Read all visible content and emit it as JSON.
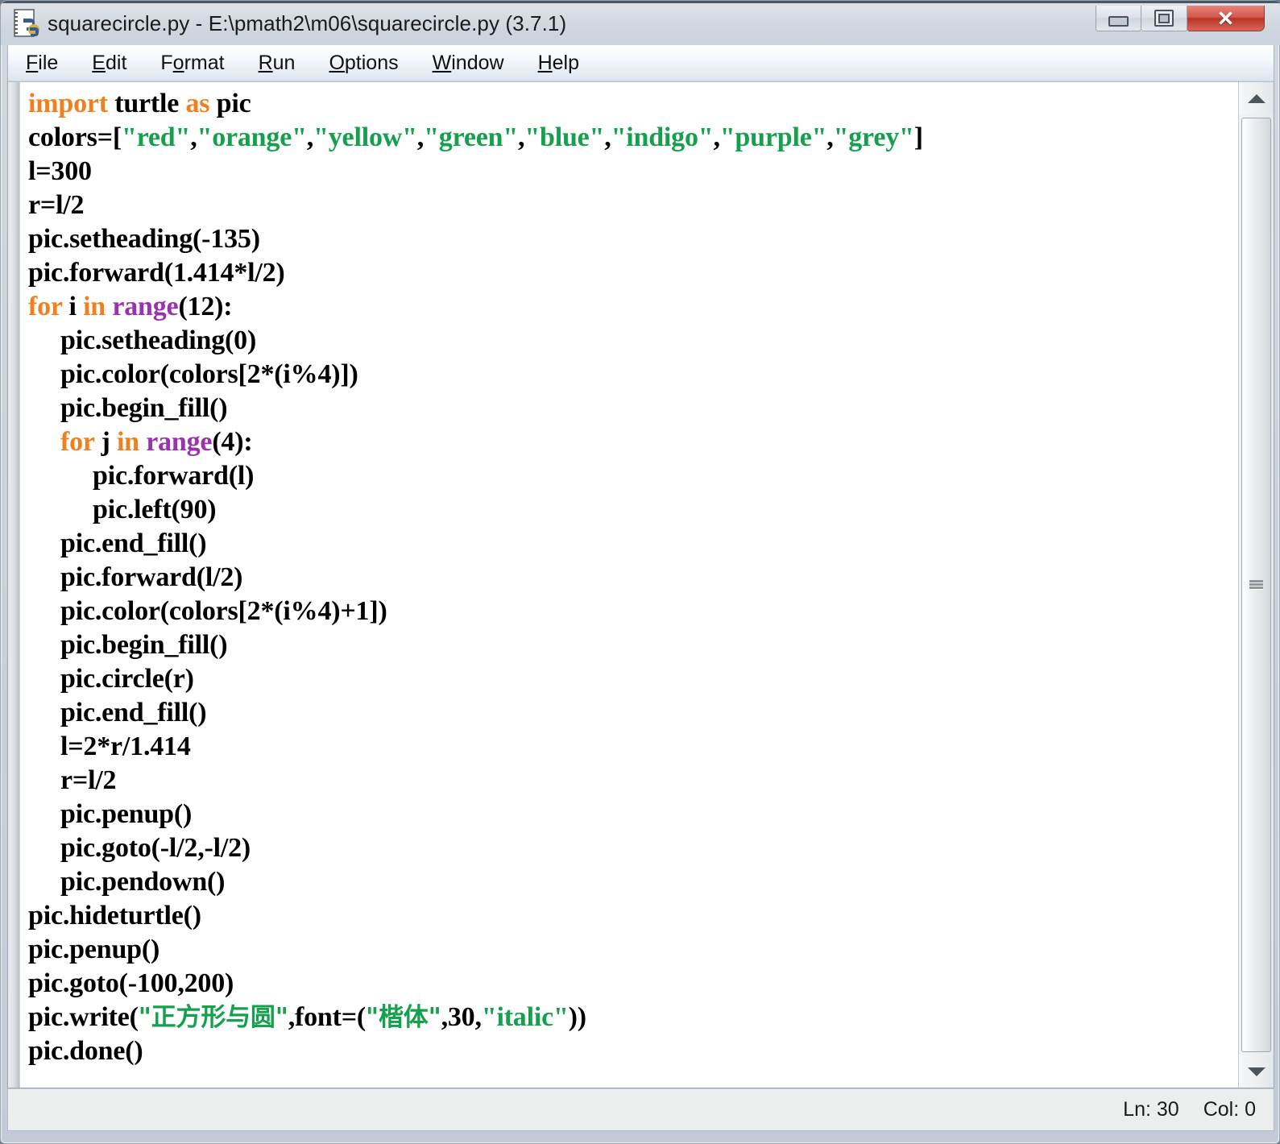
{
  "window": {
    "title": "squarecircle.py - E:\\pmath2\\m06\\squarecircle.py (3.7.1)",
    "icon": "python-file-icon",
    "controls": {
      "minimize": "minimize-icon",
      "maximize": "maximize-icon",
      "close": "✕"
    }
  },
  "menubar": {
    "items": [
      {
        "pre": "",
        "mn": "F",
        "post": "ile"
      },
      {
        "pre": "",
        "mn": "E",
        "post": "dit"
      },
      {
        "pre": "F",
        "mn": "o",
        "post": "rmat"
      },
      {
        "pre": "",
        "mn": "R",
        "post": "un"
      },
      {
        "pre": "",
        "mn": "O",
        "post": "ptions"
      },
      {
        "pre": "",
        "mn": "W",
        "post": "indow"
      },
      {
        "pre": "",
        "mn": "H",
        "post": "elp"
      }
    ]
  },
  "editor": {
    "language": "python",
    "colors": {
      "keyword": "#f0801f",
      "builtin": "#9b30b0",
      "string": "#14a04c",
      "text": "#000000",
      "background": "#ffffff"
    },
    "lines": [
      {
        "indent": 0,
        "tokens": [
          {
            "t": "import",
            "c": "kw"
          },
          {
            "t": " turtle ",
            "c": ""
          },
          {
            "t": "as",
            "c": "kw"
          },
          {
            "t": " pic",
            "c": ""
          }
        ]
      },
      {
        "indent": 0,
        "tokens": [
          {
            "t": "colors=[",
            "c": ""
          },
          {
            "t": "\"red\"",
            "c": "str"
          },
          {
            "t": ",",
            "c": ""
          },
          {
            "t": "\"orange\"",
            "c": "str"
          },
          {
            "t": ",",
            "c": ""
          },
          {
            "t": "\"yellow\"",
            "c": "str"
          },
          {
            "t": ",",
            "c": ""
          },
          {
            "t": "\"green\"",
            "c": "str"
          },
          {
            "t": ",",
            "c": ""
          },
          {
            "t": "\"blue\"",
            "c": "str"
          },
          {
            "t": ",",
            "c": ""
          },
          {
            "t": "\"indigo\"",
            "c": "str"
          },
          {
            "t": ",",
            "c": ""
          },
          {
            "t": "\"purple\"",
            "c": "str"
          },
          {
            "t": ",",
            "c": ""
          },
          {
            "t": "\"grey\"",
            "c": "str"
          },
          {
            "t": "]",
            "c": ""
          }
        ]
      },
      {
        "indent": 0,
        "tokens": [
          {
            "t": "l=300",
            "c": ""
          }
        ]
      },
      {
        "indent": 0,
        "tokens": [
          {
            "t": "r=l/2",
            "c": ""
          }
        ]
      },
      {
        "indent": 0,
        "tokens": [
          {
            "t": "pic.setheading(-135)",
            "c": ""
          }
        ]
      },
      {
        "indent": 0,
        "tokens": [
          {
            "t": "pic.forward(1.414*l/2)",
            "c": ""
          }
        ]
      },
      {
        "indent": 0,
        "tokens": [
          {
            "t": "for",
            "c": "kw"
          },
          {
            "t": " i ",
            "c": ""
          },
          {
            "t": "in",
            "c": "kw"
          },
          {
            "t": " ",
            "c": ""
          },
          {
            "t": "range",
            "c": "bi"
          },
          {
            "t": "(12):",
            "c": ""
          }
        ]
      },
      {
        "indent": 1,
        "tokens": [
          {
            "t": "pic.setheading(0)",
            "c": ""
          }
        ]
      },
      {
        "indent": 1,
        "tokens": [
          {
            "t": "pic.color(colors[2*(i%4)])",
            "c": ""
          }
        ]
      },
      {
        "indent": 1,
        "tokens": [
          {
            "t": "pic.begin_fill()",
            "c": ""
          }
        ]
      },
      {
        "indent": 1,
        "tokens": [
          {
            "t": "for",
            "c": "kw"
          },
          {
            "t": " j ",
            "c": ""
          },
          {
            "t": "in",
            "c": "kw"
          },
          {
            "t": " ",
            "c": ""
          },
          {
            "t": "range",
            "c": "bi"
          },
          {
            "t": "(4):",
            "c": ""
          }
        ]
      },
      {
        "indent": 2,
        "tokens": [
          {
            "t": "pic.forward(l)",
            "c": ""
          }
        ]
      },
      {
        "indent": 2,
        "tokens": [
          {
            "t": "pic.left(90)",
            "c": ""
          }
        ]
      },
      {
        "indent": 1,
        "tokens": [
          {
            "t": "pic.end_fill()",
            "c": ""
          }
        ]
      },
      {
        "indent": 1,
        "tokens": [
          {
            "t": "pic.forward(l/2)",
            "c": ""
          }
        ]
      },
      {
        "indent": 1,
        "tokens": [
          {
            "t": "pic.color(colors[2*(i%4)+1])",
            "c": ""
          }
        ]
      },
      {
        "indent": 1,
        "tokens": [
          {
            "t": "pic.begin_fill()",
            "c": ""
          }
        ]
      },
      {
        "indent": 1,
        "tokens": [
          {
            "t": "pic.circle(r)",
            "c": ""
          }
        ]
      },
      {
        "indent": 1,
        "tokens": [
          {
            "t": "pic.end_fill()",
            "c": ""
          }
        ]
      },
      {
        "indent": 1,
        "tokens": [
          {
            "t": "l=2*r/1.414",
            "c": ""
          }
        ]
      },
      {
        "indent": 1,
        "tokens": [
          {
            "t": "r=l/2",
            "c": ""
          }
        ]
      },
      {
        "indent": 1,
        "tokens": [
          {
            "t": "pic.penup()",
            "c": ""
          }
        ]
      },
      {
        "indent": 1,
        "tokens": [
          {
            "t": "pic.goto(-l/2,-l/2)",
            "c": ""
          }
        ]
      },
      {
        "indent": 1,
        "tokens": [
          {
            "t": "pic.pendown()",
            "c": ""
          }
        ]
      },
      {
        "indent": 0,
        "tokens": [
          {
            "t": "pic.hideturtle()",
            "c": ""
          }
        ]
      },
      {
        "indent": 0,
        "tokens": [
          {
            "t": "pic.penup()",
            "c": ""
          }
        ]
      },
      {
        "indent": 0,
        "tokens": [
          {
            "t": "pic.goto(-100,200)",
            "c": ""
          }
        ]
      },
      {
        "indent": 0,
        "tokens": [
          {
            "t": "pic.write(",
            "c": ""
          },
          {
            "t": "\"正方形与圆\"",
            "c": "str cjk"
          },
          {
            "t": ",font=(",
            "c": ""
          },
          {
            "t": "\"楷体\"",
            "c": "str cjk"
          },
          {
            "t": ",30,",
            "c": ""
          },
          {
            "t": "\"italic\"",
            "c": "str"
          },
          {
            "t": "))",
            "c": ""
          }
        ]
      },
      {
        "indent": 0,
        "tokens": [
          {
            "t": "pic.done()",
            "c": ""
          }
        ]
      }
    ]
  },
  "scrollbar": {
    "up_arrow": "scroll-up-icon",
    "down_arrow": "scroll-down-icon",
    "thumb": "scroll-thumb"
  },
  "statusbar": {
    "line": "Ln: 30",
    "column": "Col: 0"
  }
}
